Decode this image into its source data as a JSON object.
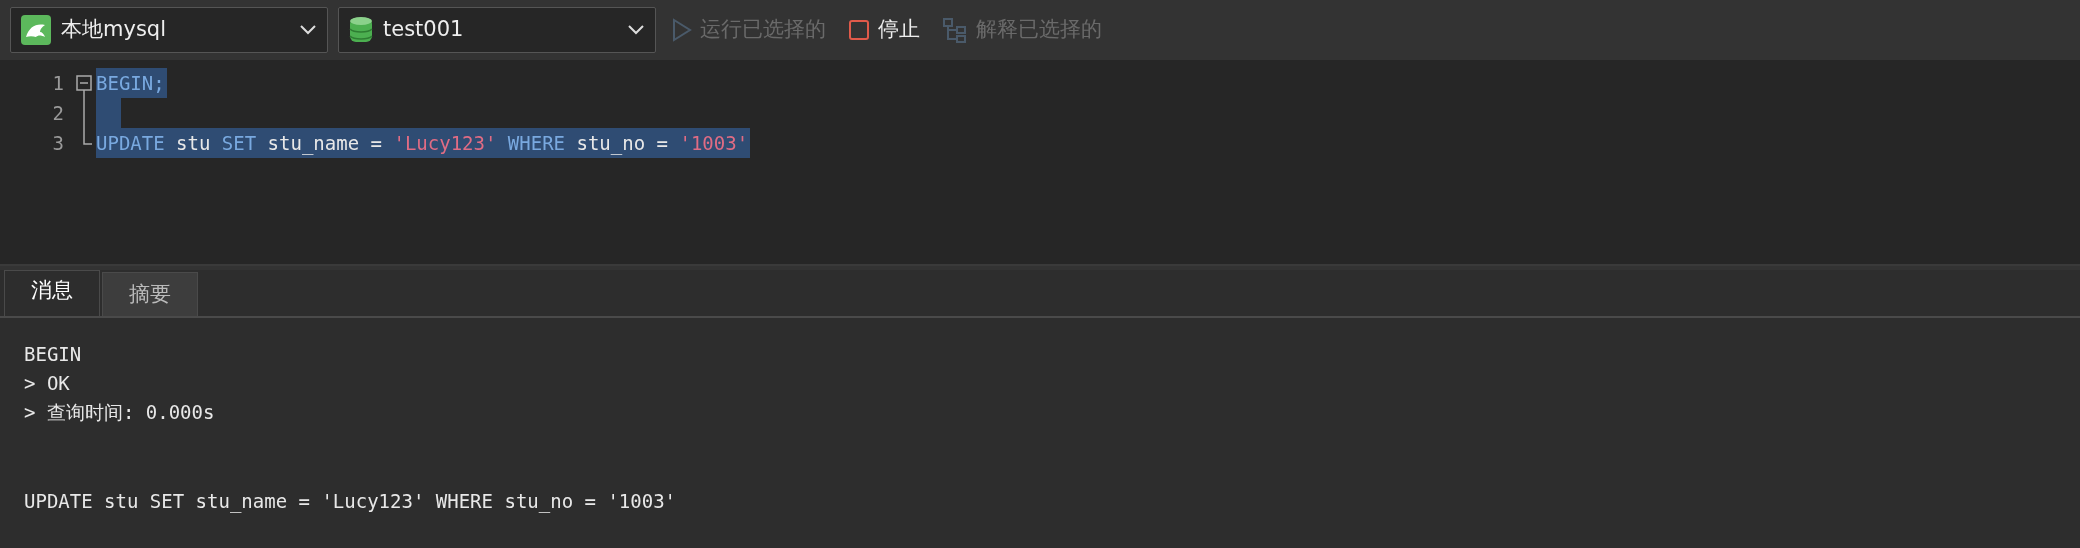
{
  "toolbar": {
    "connection": {
      "value": "本地mysql"
    },
    "database": {
      "value": "test001"
    },
    "actions": [
      {
        "kind": "run",
        "label": "运行已选择的",
        "disabled": true
      },
      {
        "kind": "stop",
        "label": "停止",
        "disabled": false
      },
      {
        "kind": "explain",
        "label": "解释已选择的",
        "disabled": true
      }
    ]
  },
  "editor": {
    "lines": [
      {
        "number": "1",
        "kind": "start",
        "selected": true,
        "tokens": [
          {
            "kind": "keyword",
            "text": "BEGIN;"
          }
        ]
      },
      {
        "number": "2",
        "kind": "middle",
        "selected": true
      },
      {
        "number": "3",
        "kind": "end",
        "selected": true,
        "tokens": [
          {
            "kind": "keyword",
            "text": "UPDATE"
          },
          {
            "kind": "plain",
            "text": " stu "
          },
          {
            "kind": "keyword",
            "text": "SET"
          },
          {
            "kind": "plain",
            "text": " stu_name = "
          },
          {
            "kind": "string",
            "text": "'Lucy123'"
          },
          {
            "kind": "keyword",
            "text": " WHERE"
          },
          {
            "kind": "plain",
            "text": " stu_no = "
          },
          {
            "kind": "string",
            "text": "'1003'"
          }
        ]
      }
    ]
  },
  "result_tabs": [
    {
      "label": "消息",
      "selected": true
    },
    {
      "label": "摘要",
      "selected": false
    }
  ],
  "messages": [
    {
      "lines": [
        "BEGIN",
        "> OK",
        "> 查询时间: 0.000s"
      ]
    },
    {
      "lines": [
        "UPDATE stu SET stu_name = 'Lucy123' WHERE stu_no = '1003'"
      ]
    }
  ]
}
